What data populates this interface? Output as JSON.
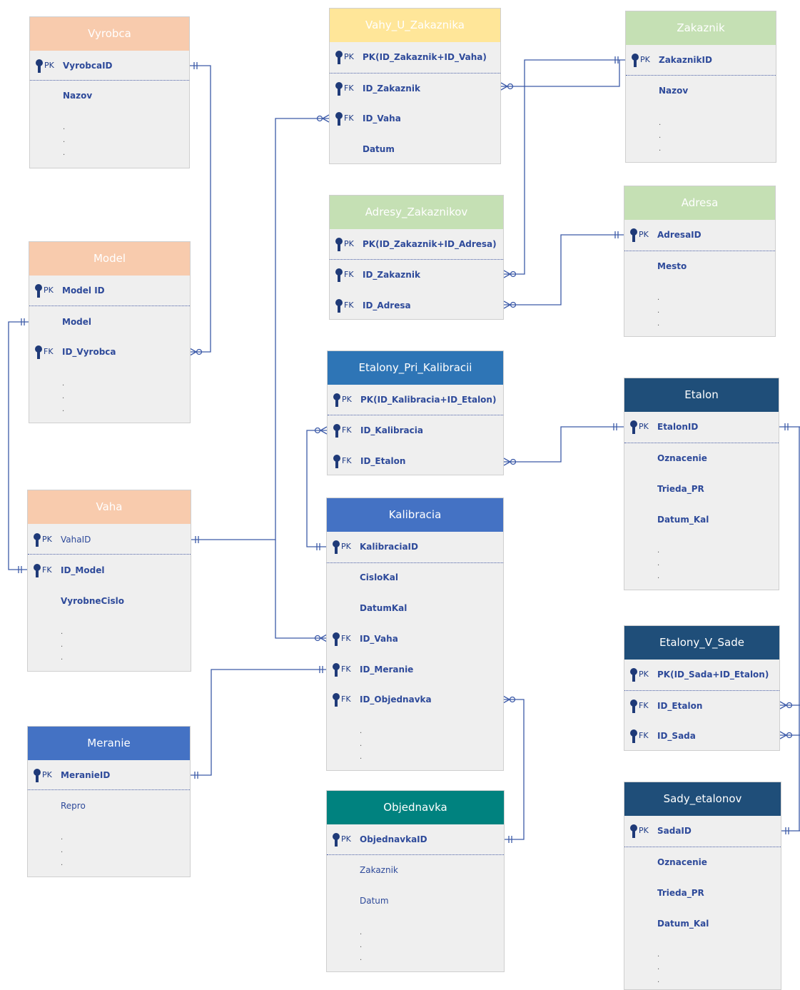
{
  "entities": {
    "vyrobca": {
      "title": "Vyrobca",
      "pk": "VyrobcaID",
      "f1": "Nazov"
    },
    "model": {
      "title": "Model",
      "pk": "Model ID",
      "f1": "Model",
      "fk1": "ID_Vyrobca"
    },
    "vaha": {
      "title": "Vaha",
      "pk": "VahaID",
      "fk1": "ID_Model",
      "f1": "VyrobneCislo"
    },
    "meranie": {
      "title": "Meranie",
      "pk": "MeranieID",
      "f1": "Repro"
    },
    "vahy_u_zakaznika": {
      "title": "Vahy_U_Zakaznika",
      "pk": "PK(ID_Zakaznik+ID_Vaha)",
      "fk1": "ID_Zakaznik",
      "fk2": "ID_Vaha",
      "f1": "Datum"
    },
    "adresy_zakaznikov": {
      "title": "Adresy_Zakaznikov",
      "pk": "PK(ID_Zakaznik+ID_Adresa)",
      "fk1": "ID_Zakaznik",
      "fk2": "ID_Adresa"
    },
    "etalony_pri_kalibracii": {
      "title": "Etalony_Pri_Kalibracii",
      "pk": "PK(ID_Kalibracia+ID_Etalon)",
      "fk1": "ID_Kalibracia",
      "fk2": "ID_Etalon"
    },
    "kalibracia": {
      "title": "Kalibracia",
      "pk": "KalibraciaID",
      "f1": "CisloKal",
      "f2": "DatumKal",
      "fk1": "ID_Vaha",
      "fk2": "ID_Meranie",
      "fk3": "ID_Objednavka"
    },
    "objednavka": {
      "title": "Objednavka",
      "pk": "ObjednavkaID",
      "f1": "Zakaznik",
      "f2": "Datum"
    },
    "zakaznik": {
      "title": "Zakaznik",
      "pk": "ZakaznikID",
      "f1": "Nazov"
    },
    "adresa": {
      "title": "Adresa",
      "pk": "AdresaID",
      "f1": "Mesto"
    },
    "etalon": {
      "title": "Etalon",
      "pk": "EtalonID",
      "f1": "Oznacenie",
      "f2": "Trieda_PR",
      "f3": "Datum_Kal"
    },
    "etalony_v_sade": {
      "title": "Etalony_V_Sade",
      "pk": "PK(ID_Sada+ID_Etalon)",
      "fk1": "ID_Etalon",
      "fk2": "ID_Sada"
    },
    "sady_etalonov": {
      "title": "Sady_etalonov",
      "pk": "SadaID",
      "f1": "Oznacenie",
      "f2": "Trieda_PR",
      "f3": "Datum_Kal"
    }
  },
  "labels": {
    "pk": "PK",
    "fk": "FK",
    "dots": ".\n.\n."
  },
  "colors": {
    "orange": "#f8cbad",
    "yellow": "#ffe699",
    "green": "#c5e0b4",
    "blue": "#4472c4",
    "darkblue": "#1f4e79",
    "teal": "#00827f",
    "line": "#3c5aa8",
    "key": "#1f3a78"
  }
}
